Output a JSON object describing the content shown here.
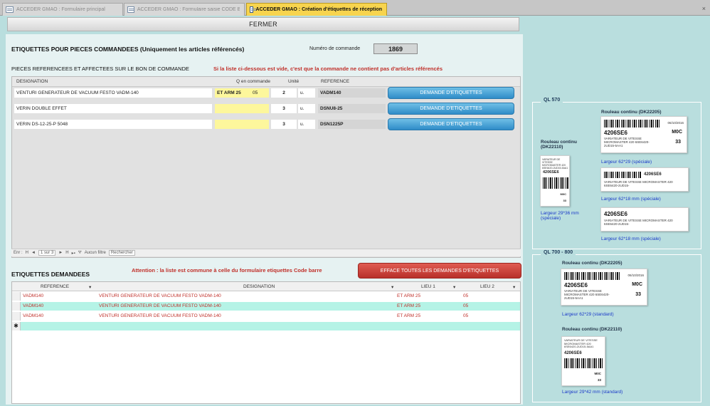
{
  "tabs": [
    {
      "label": "ACCEDER GMAO : Formulaire principal"
    },
    {
      "label": "ACCEDER GMAO : Formulaire saisie CODE BARRE"
    },
    {
      "label": "ACCEDER GMAO : Création d'étiquettes de réception"
    }
  ],
  "tab_close": "×",
  "header": {
    "close_label": "FERMER"
  },
  "section1": {
    "title": "ETIQUETTES POUR PIECES COMMANDEES (Uniquement les articles référencés)",
    "order_label": "Numéro de commande",
    "order_value": "1869",
    "subtitle": "PIECES REFERENCEES ET AFFECTEES SUR LE BON DE COMMANDE",
    "warning": "Si la liste ci-dessous est vide, c'est que la commande ne contient pas d'articles référencés"
  },
  "table1": {
    "headers": {
      "designation": "DESIGNATION",
      "qty": "Q en commande",
      "unit": "Unité",
      "reference": "REFERENCE"
    },
    "button_label": "DEMANDE D'ETIQUETTES",
    "rows": [
      {
        "designation": "VENTURI GENERATEUR DE VACUUM FESTO VADM-140",
        "lieu1": "ET ARM 25",
        "lieu2": "05",
        "qty": "2",
        "unit": "u.",
        "reference": "VADM140"
      },
      {
        "designation": "VERIN DOUBLE EFFET",
        "lieu1": "",
        "lieu2": "",
        "qty": "3",
        "unit": "u.",
        "reference": "DSNU8-25"
      },
      {
        "designation": "VERIN DS-12-25-P 5048",
        "lieu1": "",
        "lieu2": "",
        "qty": "3",
        "unit": "u.",
        "reference": "DSN1225P"
      }
    ]
  },
  "navigation": {
    "record_label": "Enr :",
    "first": "H",
    "prev": "◄",
    "position": "1 sur 3",
    "next": "►",
    "last": "H",
    "new": "▸▪",
    "filter": "Aucun filtre",
    "search": "Rechercher"
  },
  "section2": {
    "title": "ETIQUETTES DEMANDEES",
    "warning": "Attention : la liste est commune à celle du formulaire etiquettes Code barre",
    "clear_button": "EFFACE TOUTES LES DEMANDES D'ETIQUETTES"
  },
  "table2": {
    "headers": {
      "reference": "REFERENCE",
      "designation": "DESIGNATION",
      "lieu1": "LIEU 1",
      "lieu2": "LIEU 2"
    },
    "sort_glyph": "▾",
    "new_row_marker": "✱",
    "rows": [
      {
        "reference": "VADM140",
        "designation": "VENTURI GENERATEUR DE VACUUM FESTO VADM-140",
        "lieu1": "ET ARM 25",
        "lieu2": "05"
      },
      {
        "reference": "VADM140",
        "designation": "VENTURI GENERATEUR DE VACUUM FESTO VADM-140",
        "lieu1": "ET ARM 25",
        "lieu2": "05"
      },
      {
        "reference": "VADM140",
        "designation": "VENTURI GENERATEUR DE VACUUM FESTO VADM-140",
        "lieu1": "ET ARM 25",
        "lieu2": "05"
      }
    ]
  },
  "ql570": {
    "legend": "QL 570",
    "roll_dk22205": "Rouleau continu (DK22205)",
    "roll_dk22110": "Rouleau continu (DK22110)",
    "label_date": "06/10/2016",
    "label_code": "4206SE6",
    "label_code_suffix": "M0C",
    "label_qty": "33",
    "label_text": "VARIATEUR DE VITESSE MICROMASTER 420 6SE6420-2UD15-5AA1",
    "label_text_short": "VARIATEUR DE VITESSE MICROMASTER 420 6SE6420-2UD15-",
    "width_62x29": "Largeur 62*29 (spéciale)",
    "width_62x18_a": "Largeur 62*18 mm (spéciale)",
    "width_62x18_b": "Largeur 62*18 mm (spéciale)",
    "width_29x36": "Largeur 29*36 mm (spéciale)"
  },
  "ql700": {
    "legend": "QL 700 - 800",
    "roll_dk22205": "Rouleau continu (DK22205)",
    "roll_dk22110": "Rouleau continu (DK22110)",
    "width_62x29": "Largeur 62*29 (standard)",
    "width_29x42": "Largeur 29*42 mm (standard)"
  },
  "colors": {
    "tab_active": "#f7d44e",
    "panel_bg": "#b9dede",
    "button_blue": "#2f8cc8",
    "button_red": "#b8302a",
    "row_alt": "#b5f3e6",
    "field_yellow": "#fdf79c"
  }
}
